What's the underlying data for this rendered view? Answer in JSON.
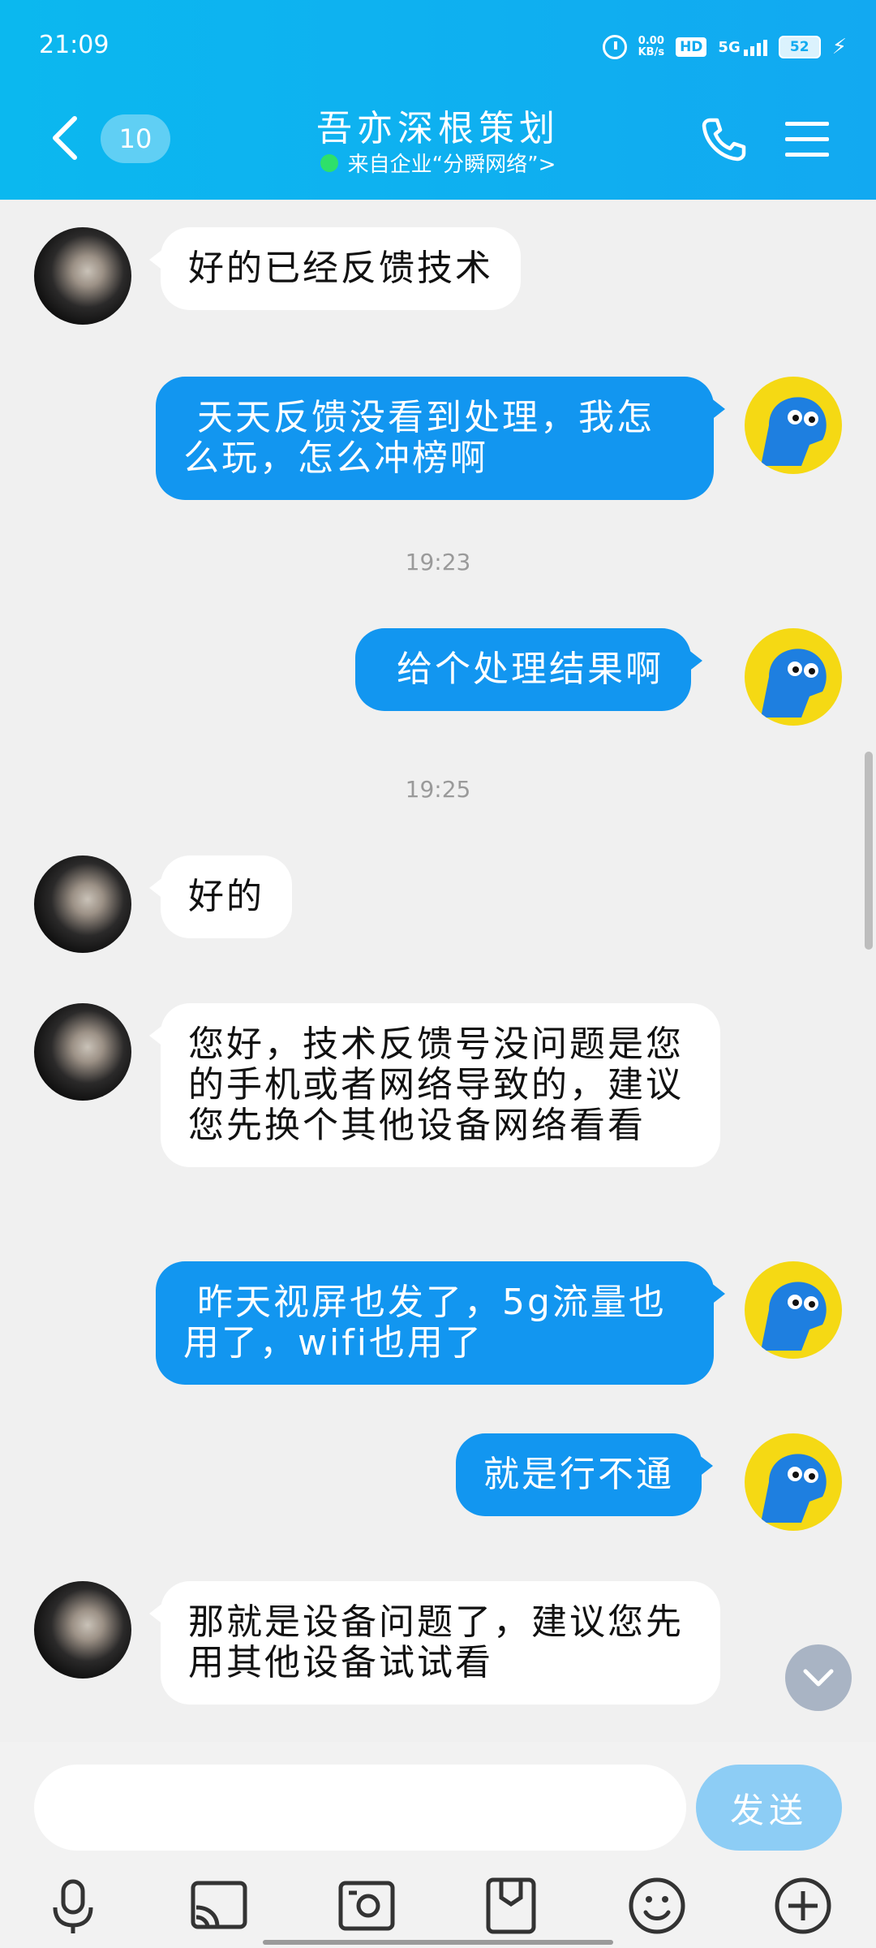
{
  "status_bar": {
    "time": "21:09",
    "net_speed_value": "0.00",
    "net_speed_unit": "KB/s",
    "hd_label": "HD",
    "network_label": "5G",
    "battery_level": "52"
  },
  "header": {
    "unread_count": "10",
    "title": "吾亦深根策划",
    "subtitle": "来自企业“分瞬网络”>",
    "status_color": "#2ee06a"
  },
  "messages": [
    {
      "side": "in",
      "text": "好的已经反馈技术"
    },
    {
      "side": "out",
      "text": " 天天反馈没看到处理，我怎么玩，怎么冲榜啊"
    },
    {
      "type": "time",
      "text": "19:23"
    },
    {
      "side": "out",
      "text": " 给个处理结果啊"
    },
    {
      "type": "time",
      "text": "19:25"
    },
    {
      "side": "in",
      "text": "好的"
    },
    {
      "side": "in",
      "text": "您好，技术反馈号没问题是您的手机或者网络导致的，建议您先换个其他设备网络看看"
    },
    {
      "side": "out",
      "text": " 昨天视屏也发了，5g流量也用了，wifi也用了"
    },
    {
      "side": "out",
      "text": "就是行不通"
    },
    {
      "side": "in",
      "text": "那就是设备问题了，建议您先用其他设备试试看"
    }
  ],
  "input": {
    "value": "",
    "send_label": "发送"
  },
  "toolbar_icons": [
    "microphone-icon",
    "screen-cast-icon",
    "photo-icon",
    "folder-icon",
    "emoji-icon",
    "plus-icon"
  ],
  "colors": {
    "header_bg": "#0bb8ef",
    "outgoing_bubble": "#1296f0",
    "incoming_bubble": "#ffffff",
    "send_button": "#8dcdf5"
  }
}
